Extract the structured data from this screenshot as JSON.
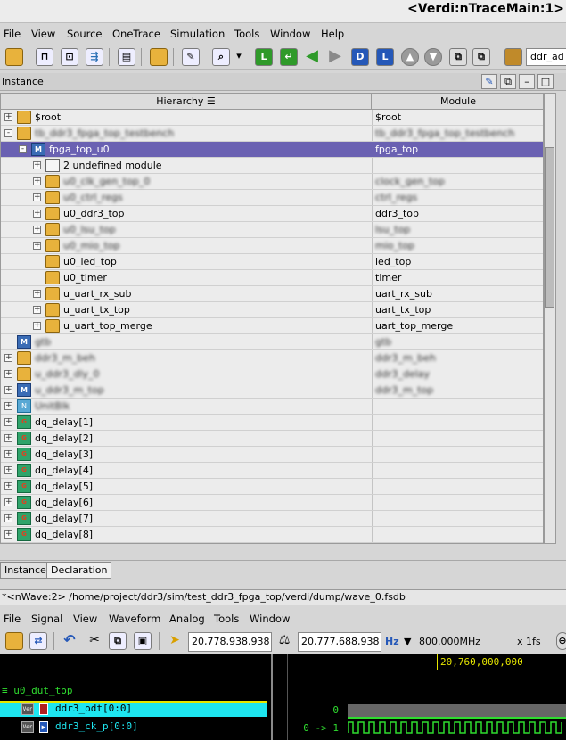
{
  "window": {
    "title": "<Verdi:nTraceMain:1>"
  },
  "menu": [
    "File",
    "View",
    "Source",
    "OneTrace",
    "Simulation",
    "Tools",
    "Window",
    "Help"
  ],
  "toolbar": {
    "combo_value": "ddr_ad"
  },
  "instance_panel": {
    "label": "Instance"
  },
  "tree": {
    "columns": {
      "hierarchy": "Hierarchy",
      "module": "Module"
    },
    "rows": [
      {
        "name": "$root",
        "module": "$root",
        "indent": 0,
        "expander": "+",
        "icon": "folder",
        "blur": false
      },
      {
        "name": "tb_ddr3_fpga_top_testbench",
        "module": "tb_ddr3_fpga_top_testbench",
        "indent": 0,
        "expander": "-",
        "icon": "folder",
        "blur": true
      },
      {
        "name": "fpga_top_u0",
        "module": "fpga_top",
        "indent": 1,
        "expander": "-",
        "icon": "m",
        "blur": false,
        "selected": true
      },
      {
        "name": "2 undefined module",
        "module": "",
        "indent": 2,
        "expander": "+",
        "icon": "doc",
        "blur": false
      },
      {
        "name": "u0_clk_gen_top_0",
        "module": "clock_gen_top",
        "indent": 2,
        "expander": "+",
        "icon": "folder",
        "blur": true
      },
      {
        "name": "u0_ctrl_regs",
        "module": "ctrl_regs",
        "indent": 2,
        "expander": "+",
        "icon": "folder",
        "blur": true
      },
      {
        "name": "u0_ddr3_top",
        "module": "ddr3_top",
        "indent": 2,
        "expander": "+",
        "icon": "folder",
        "blur": false
      },
      {
        "name": "u0_lsu_top",
        "module": "lsu_top",
        "indent": 2,
        "expander": "+",
        "icon": "folder",
        "blur": true
      },
      {
        "name": "u0_mio_top",
        "module": "mio_top",
        "indent": 2,
        "expander": "+",
        "icon": "folder",
        "blur": true
      },
      {
        "name": "u0_led_top",
        "module": "led_top",
        "indent": 2,
        "expander": "",
        "icon": "folder",
        "blur": false
      },
      {
        "name": "u0_timer",
        "module": "timer",
        "indent": 2,
        "expander": "",
        "icon": "folder",
        "blur": false
      },
      {
        "name": "u_uart_rx_sub",
        "module": "uart_rx_sub",
        "indent": 2,
        "expander": "+",
        "icon": "folder",
        "blur": false
      },
      {
        "name": "u_uart_tx_top",
        "module": "uart_tx_top",
        "indent": 2,
        "expander": "+",
        "icon": "folder",
        "blur": false
      },
      {
        "name": "u_uart_top_merge",
        "module": "uart_top_merge",
        "indent": 2,
        "expander": "+",
        "icon": "folder",
        "blur": false
      },
      {
        "name": "gtb",
        "module": "gtb",
        "indent": 0,
        "expander": "",
        "icon": "m",
        "blur": true
      },
      {
        "name": "ddr3_m_beh",
        "module": "ddr3_m_beh",
        "indent": 0,
        "expander": "+",
        "icon": "folder",
        "blur": true
      },
      {
        "name": "u_ddr3_dly_0",
        "module": "ddr3_delay",
        "indent": 0,
        "expander": "+",
        "icon": "folder",
        "blur": true
      },
      {
        "name": "u_ddr3_m_top",
        "module": "ddr3_m_top",
        "indent": 0,
        "expander": "+",
        "icon": "m",
        "blur": true
      },
      {
        "name": "UnitBlk",
        "module": "",
        "indent": 0,
        "expander": "+",
        "icon": "sm",
        "blur": true
      },
      {
        "name": "dq_delay[1]",
        "module": "",
        "indent": 0,
        "expander": "+",
        "icon": "gen",
        "blur": false
      },
      {
        "name": "dq_delay[2]",
        "module": "",
        "indent": 0,
        "expander": "+",
        "icon": "gen",
        "blur": false
      },
      {
        "name": "dq_delay[3]",
        "module": "",
        "indent": 0,
        "expander": "+",
        "icon": "gen",
        "blur": false
      },
      {
        "name": "dq_delay[4]",
        "module": "",
        "indent": 0,
        "expander": "+",
        "icon": "gen",
        "blur": false
      },
      {
        "name": "dq_delay[5]",
        "module": "",
        "indent": 0,
        "expander": "+",
        "icon": "gen",
        "blur": false
      },
      {
        "name": "dq_delay[6]",
        "module": "",
        "indent": 0,
        "expander": "+",
        "icon": "gen",
        "blur": false
      },
      {
        "name": "dq_delay[7]",
        "module": "",
        "indent": 0,
        "expander": "+",
        "icon": "gen",
        "blur": false
      },
      {
        "name": "dq_delay[8]",
        "module": "",
        "indent": 0,
        "expander": "+",
        "icon": "gen",
        "blur": false
      }
    ]
  },
  "tabs": {
    "instance": "Instance",
    "declaration": "Declaration"
  },
  "nwave": {
    "title": "*<nWave:2> /home/project/ddr3/sim/test_ddr3_fpga_top/verdi/dump/wave_0.fsdb",
    "menu": [
      "File",
      "Signal",
      "View",
      "Waveform",
      "Analog",
      "Tools",
      "Window"
    ],
    "time1": "20,778,938,938",
    "time2": "20,777,688,938",
    "freq_unit": "Hz",
    "freq": "800.000MHz",
    "resolution": "x 1fs",
    "ruler_time": "20,760,000,000",
    "group": "u0_dut_top",
    "signals": [
      {
        "name": "ddr3_odt[0:0]",
        "value": "0",
        "selected": true
      },
      {
        "name": "ddr3_ck_p[0:0]",
        "value": "0 -> 1",
        "selected": false
      }
    ]
  }
}
